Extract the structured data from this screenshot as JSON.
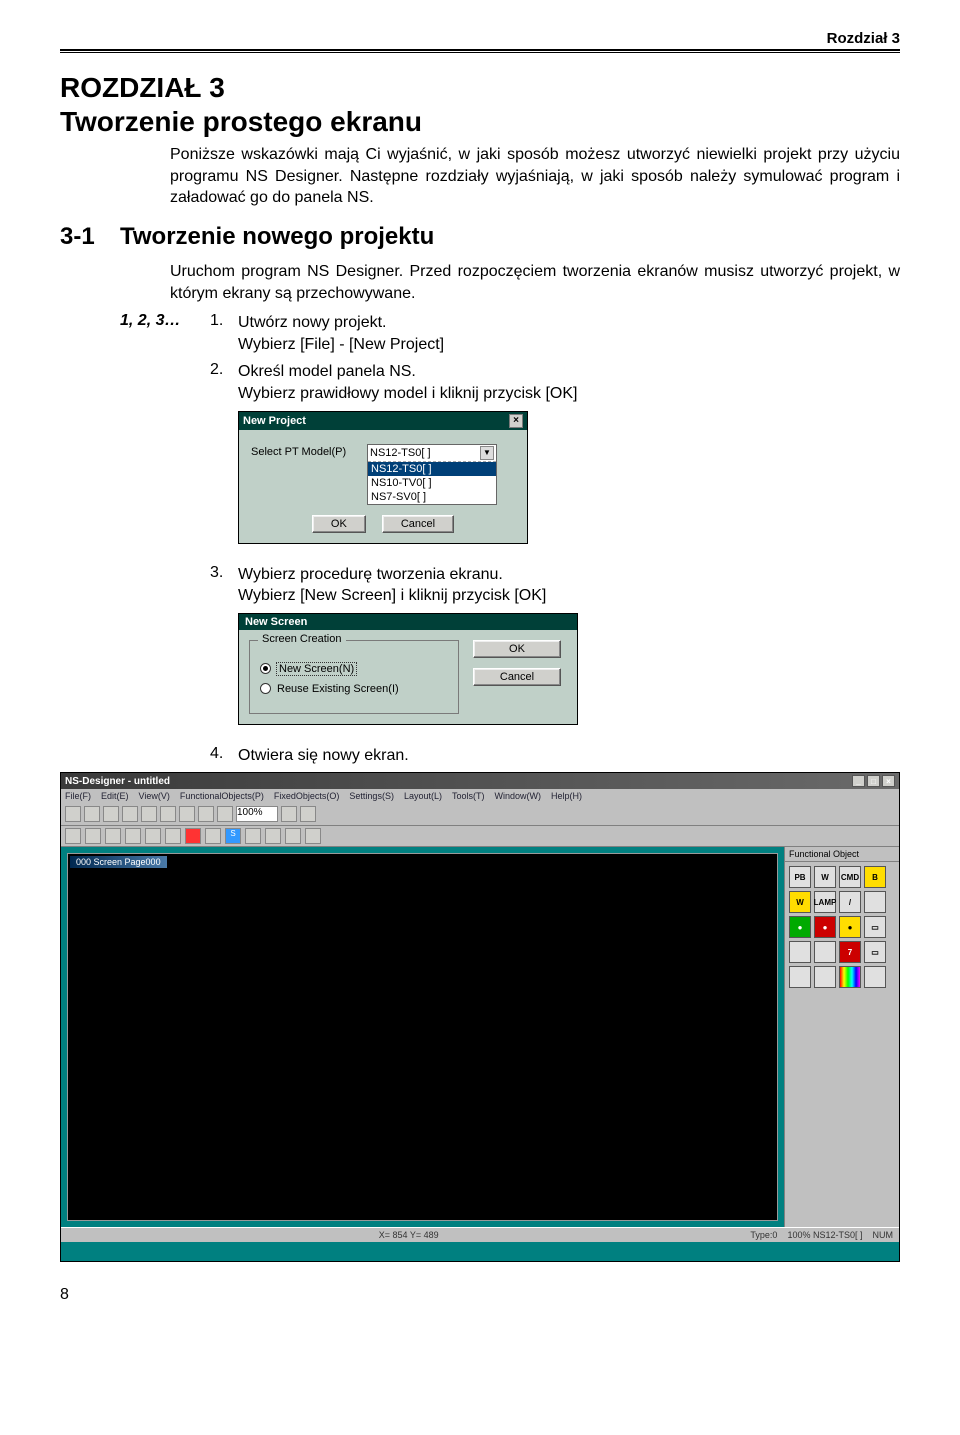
{
  "header": {
    "chapter": "Rozdział 3"
  },
  "title1": "ROZDZIAŁ 3",
  "title2": "Tworzenie prostego ekranu",
  "intro": "Poniższe wskazówki mają Ci wyjaśnić, w jaki sposób możesz utworzyć niewielki projekt przy użyciu programu NS Designer. Następne rozdziały wyjaśniają, w jaki sposób należy symulować program i załadować go do panela NS.",
  "sec": {
    "num": "3-1",
    "title": "Tworzenie nowego projektu"
  },
  "body": "Uruchom program NS Designer. Przed rozpoczęciem tworzenia ekranów musisz utworzyć projekt, w którym ekrany są przechowywane.",
  "stepsLabel": "1, 2, 3…",
  "steps": {
    "s1num": "1.",
    "s1a": "Utwórz nowy projekt.",
    "s1b": "Wybierz [File] - [New Project]",
    "s2num": "2.",
    "s2a": "Określ model panela NS.",
    "s2b": "Wybierz prawidłowy model i kliknij przycisk [OK]",
    "s3num": "3.",
    "s3a": "Wybierz procedurę tworzenia ekranu.",
    "s3b": "Wybierz [New Screen] i kliknij przycisk [OK]",
    "s4num": "4.",
    "s4a": "Otwiera się nowy ekran."
  },
  "dlg1": {
    "title": "New Project",
    "close": "×",
    "label": "Select PT Model(P)",
    "combo": {
      "sel": "NS12-TS0[ ]",
      "items": [
        "NS12-TS0[ ]",
        "NS10-TV0[ ]",
        "NS7-SV0[ ]"
      ]
    },
    "ok": "OK",
    "cancel": "Cancel"
  },
  "dlg2": {
    "title": "New Screen",
    "group": "Screen Creation",
    "r1": "New Screen(N)",
    "r2": "Reuse Existing Screen(I)",
    "ok": "OK",
    "cancel": "Cancel"
  },
  "app": {
    "title": "NS-Designer - untitled",
    "menu": [
      "File(F)",
      "Edit(E)",
      "View(V)",
      "FunctionalObjects(P)",
      "FixedObjects(O)",
      "Settings(S)",
      "Layout(L)",
      "Tools(T)",
      "Window(W)",
      "Help(H)"
    ],
    "zoom": "100%",
    "canvasTitle": "000 Screen Page000",
    "rightPanel": "Functional Object",
    "palette": [
      "PB",
      "W",
      "CMD",
      "B",
      "W",
      "LAMP",
      "/",
      "",
      "●",
      "●",
      "●",
      "▭",
      "",
      "",
      "7",
      "▭",
      "",
      "",
      "",
      ""
    ],
    "statusL": "X= 854 Y= 489",
    "statusM": "Type:0",
    "statusR": "100%  NS12-TS0[ ]",
    "statusNum": "NUM"
  },
  "pageNumber": "8"
}
